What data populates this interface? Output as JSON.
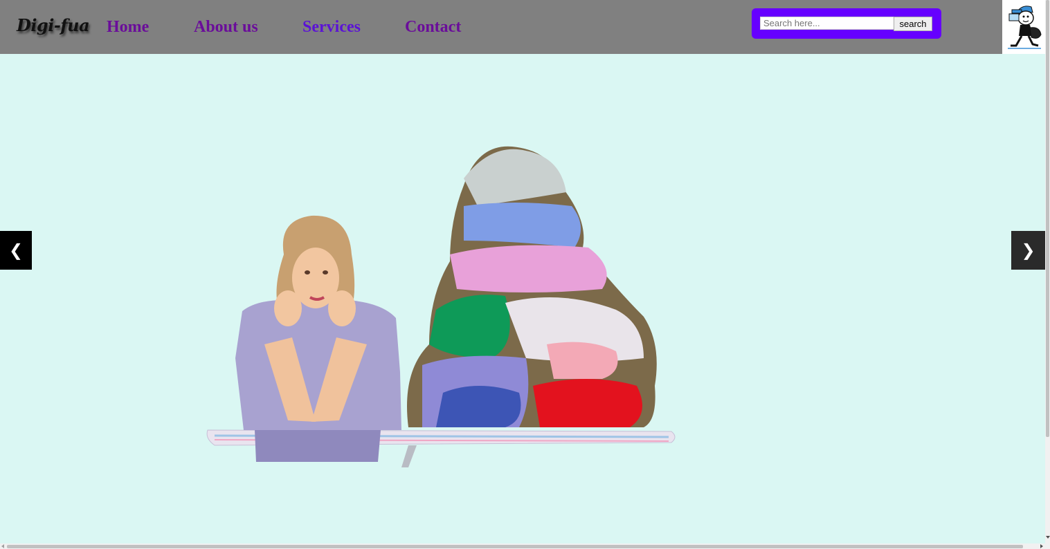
{
  "header": {
    "logo": "Digi-fua",
    "nav": {
      "home": "Home",
      "about": "About us",
      "services": "Services",
      "contact": "Contact"
    },
    "search": {
      "placeholder": "Search here...",
      "value": "",
      "button_label": "search"
    },
    "mascot_icon": "delivery-mascot-icon"
  },
  "slider": {
    "prev_label": "❮",
    "next_label": "❯",
    "slide_image": "woman-beside-laundry-pile"
  },
  "colors": {
    "header_bg": "#808080",
    "nav_link": "#6a0d9a",
    "nav_active": "#5b12d6",
    "search_bg": "#6600ff",
    "hero_bg": "#daf7f3"
  }
}
